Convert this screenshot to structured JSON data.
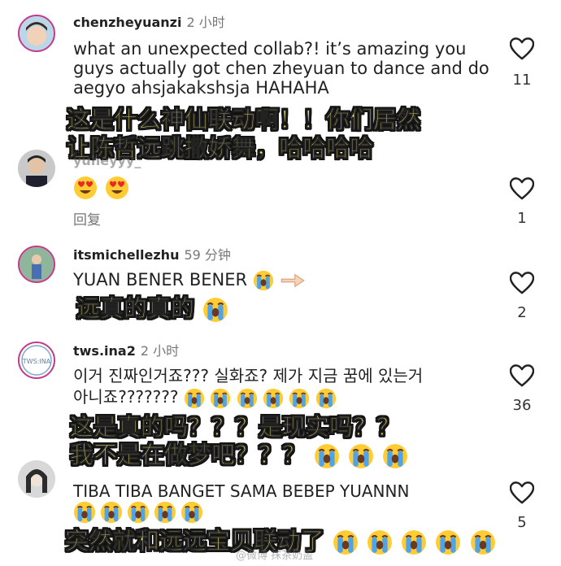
{
  "comments": [
    {
      "username": "chenzheyuanzi",
      "time": "2 小时",
      "text": "what an unexpected collab?! it’s amazing you guys actually got chen zheyuan to dance and do aegyo ahsjakakshsja HAHAHA",
      "likes": "11",
      "subtitle_line1": "这是什么神仙联动啊！！你们居然",
      "subtitle_line2": "让陈哲远跳撒娇舞，哈哈哈哈"
    },
    {
      "username": "yuheyyy_",
      "reply_label": "回复",
      "likes": "1"
    },
    {
      "username": "itsmichellezhu",
      "time": "59 分钟",
      "text": "YUAN BENER BENER",
      "likes": "2",
      "subtitle": "远真的真的"
    },
    {
      "username": "tws.ina2",
      "time": "2 小时",
      "text_line1": "이거 진짜인거죠??? 실화죠? 제가 지금 꿈에 있는거",
      "text_line2": "아니죠???????",
      "likes": "36",
      "avatar_text": "TWS:INA",
      "subtitle_line1": "这是真的吗？？？是现实吗？？",
      "subtitle_line2": "我不是在做梦吧？？？"
    },
    {
      "text": "TIBA TIBA BANGET SAMA BEBEP YUANNN",
      "likes": "5",
      "subtitle": "突然就和远远宝贝联动了"
    }
  ],
  "watermark": "@微博 抹茶奶盖",
  "colors": {
    "subtitle": "#fff27a",
    "outline": "#111111",
    "muted": "#777777"
  }
}
